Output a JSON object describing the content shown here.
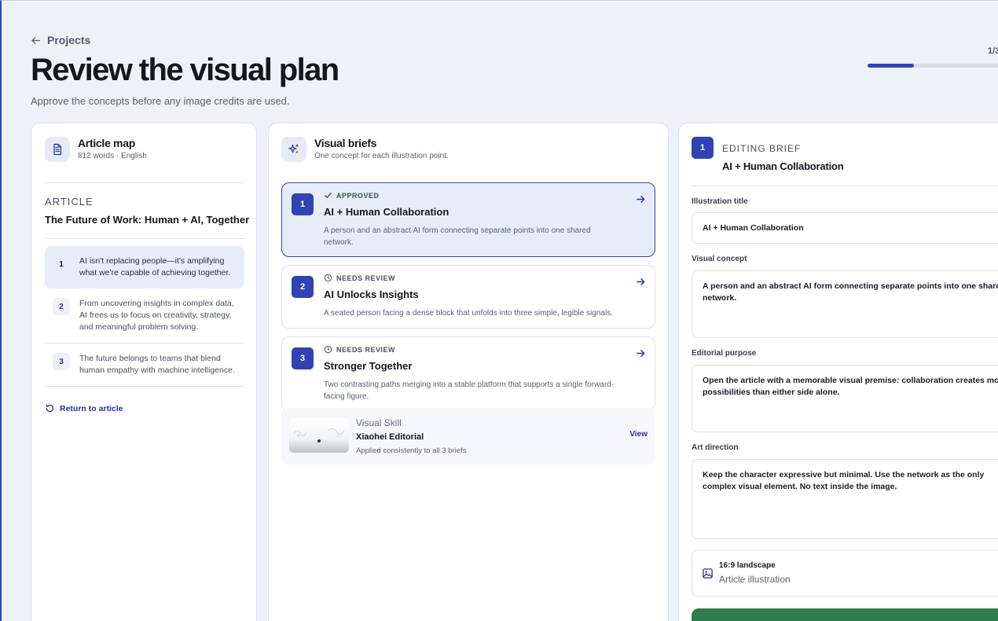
{
  "header": {
    "back_label": "Projects",
    "title": "Review the visual plan",
    "subtitle": "Approve the concepts before any image credits are used.",
    "step_label": "1/3",
    "progress_fraction": 0.33
  },
  "article_map": {
    "title": "Article map",
    "meta": "812 words · English",
    "kicker": "ARTICLE",
    "article_title": "The Future of Work: Human + AI, Together",
    "points": [
      {
        "num": "1",
        "text": "AI isn't replacing people—it's amplifying what we're capable of achieving together."
      },
      {
        "num": "2",
        "text": "From uncovering insights in complex data, AI frees us to focus on creativity, strategy, and meaningful problem solving."
      },
      {
        "num": "3",
        "text": "The future belongs to teams that blend human empathy with machine intelligence."
      }
    ],
    "return_label": "Return to article"
  },
  "visual_briefs": {
    "title": "Visual briefs",
    "subtitle": "One concept for each illustration point.",
    "briefs": [
      {
        "num": "1",
        "status": "APPROVED",
        "title": "AI + Human Collaboration",
        "desc": "A person and an abstract AI form connecting separate points into one shared network."
      },
      {
        "num": "2",
        "status": "NEEDS REVIEW",
        "title": "AI Unlocks Insights",
        "desc": "A seated person facing a dense block that unfolds into three simple, legible signals."
      },
      {
        "num": "3",
        "status": "NEEDS REVIEW",
        "title": "Stronger Together",
        "desc": "Two contrasting paths merging into a stable platform that supports a single forward-facing figure."
      }
    ],
    "skill": {
      "kicker": "Visual Skill",
      "name": "Xiaohei Editorial",
      "desc": "Applied consistently to all 3 briefs",
      "view_label": "View"
    }
  },
  "editing_brief": {
    "num": "1",
    "kicker": "EDITING BRIEF",
    "title": "AI + Human Collaboration",
    "fields": {
      "illustration_title_label": "Illustration title",
      "illustration_title_value": "AI + Human Collaboration",
      "visual_concept_label": "Visual concept",
      "visual_concept_value": "A person and an abstract AI form connecting separate points into one shared network.",
      "editorial_purpose_label": "Editorial purpose",
      "editorial_purpose_value": "Open the article with a memorable visual premise: collaboration creates more possibilities than either side alone.",
      "art_direction_label": "Art direction",
      "art_direction_value": "Keep the character expressive but minimal. Use the network as the only complex visual element. No text inside the image."
    },
    "format": {
      "title": "16:9 landscape",
      "subtitle": "Article illustration"
    }
  },
  "colors": {
    "accent": "#3142b5",
    "approved": "#2b5a43",
    "cta": "#2f7d4c",
    "background": "#eef1f8"
  }
}
